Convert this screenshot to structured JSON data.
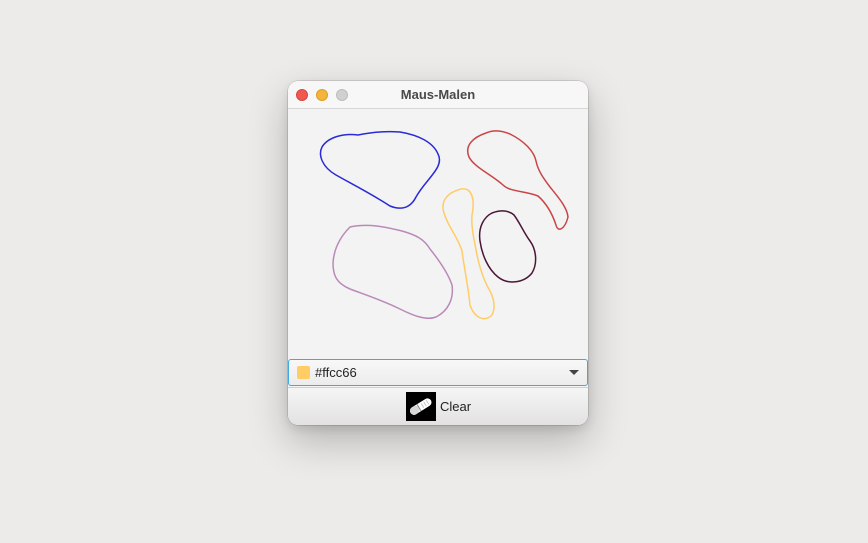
{
  "window": {
    "title": "Maus-Malen"
  },
  "colors": {
    "selected": "#ffcc66",
    "accent_border": "#3fa9e0"
  },
  "drawing": {
    "strokes": [
      {
        "color": "#2a2ad6"
      },
      {
        "color": "#c94545"
      },
      {
        "color": "#ffcc66"
      },
      {
        "color": "#4a1738"
      },
      {
        "color": "#b98ab8"
      }
    ]
  },
  "color_picker": {
    "value": "#ffcc66"
  },
  "clear_button": {
    "label": "Clear",
    "icon": "eraser-icon"
  }
}
